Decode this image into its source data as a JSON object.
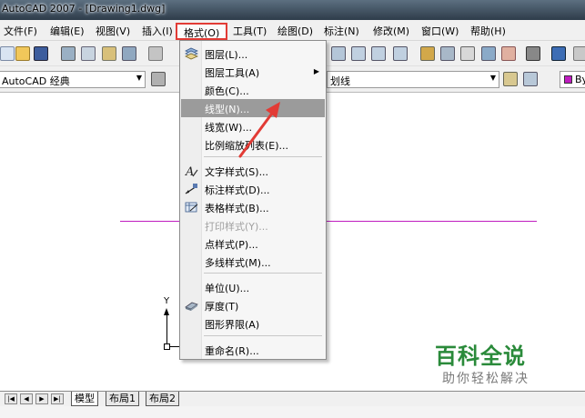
{
  "window": {
    "title": "AutoCAD 2007 - [Drawing1.dwg]"
  },
  "menubar": [
    {
      "key": "file",
      "label": "文件(F)"
    },
    {
      "key": "edit",
      "label": "编辑(E)"
    },
    {
      "key": "view",
      "label": "视图(V)"
    },
    {
      "key": "insert",
      "label": "插入(I)"
    },
    {
      "key": "format",
      "label": "格式(O)"
    },
    {
      "key": "tools",
      "label": "工具(T)"
    },
    {
      "key": "draw",
      "label": "绘图(D)"
    },
    {
      "key": "dimension",
      "label": "标注(N)"
    },
    {
      "key": "modify",
      "label": "修改(M)"
    },
    {
      "key": "window",
      "label": "窗口(W)"
    },
    {
      "key": "help",
      "label": "帮助(H)"
    }
  ],
  "toolbar2": {
    "workspace": "AutoCAD 经典",
    "linetype_text": "划线",
    "color_text": "By"
  },
  "format_menu": [
    {
      "label": "图层(L)...",
      "icon": "layers-icon"
    },
    {
      "label": "图层工具(A)",
      "submenu": "▶"
    },
    {
      "label": "颜色(C)..."
    },
    {
      "label": "线型(N)...",
      "highlighted": true
    },
    {
      "label": "线宽(W)..."
    },
    {
      "label": "比例缩放列表(E)..."
    },
    {
      "label": "文字样式(S)...",
      "icon": "text-style-icon"
    },
    {
      "label": "标注样式(D)...",
      "icon": "dimension-style-icon"
    },
    {
      "label": "表格样式(B)...",
      "icon": "table-style-icon"
    },
    {
      "label": "打印样式(Y)...",
      "disabled": true
    },
    {
      "label": "点样式(P)..."
    },
    {
      "label": "多线样式(M)..."
    },
    {
      "label": "单位(U)..."
    },
    {
      "label": "厚度(T)",
      "icon": "thickness-icon"
    },
    {
      "label": "图形界限(A)"
    },
    {
      "label": "重命名(R)..."
    }
  ],
  "ucs": {
    "y_label": "Y"
  },
  "layout_tabs": {
    "nav": [
      "|◀",
      "◀",
      "▶",
      "▶|"
    ],
    "tabs": [
      "模型",
      "布局1",
      "布局2"
    ]
  },
  "watermark": {
    "title": "百科全说",
    "subtitle": "助你轻松解决"
  },
  "colors": {
    "highlight": "#9b9b9b",
    "red_box": "#e23b35",
    "magenta_line": "#c01cc0",
    "watermark_green": "#2a8a3a"
  }
}
